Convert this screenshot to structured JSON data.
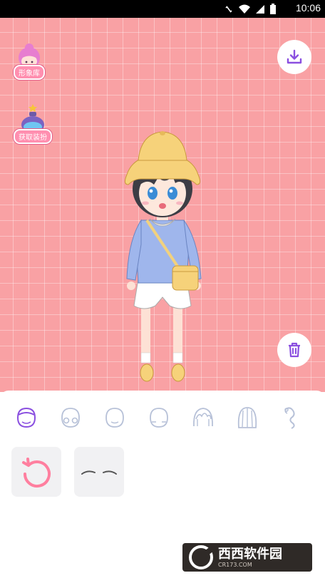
{
  "status_bar": {
    "time": "10:06",
    "icons": [
      "no-vibrate-icon",
      "wifi-icon",
      "signal-icon",
      "battery-icon"
    ]
  },
  "canvas": {
    "background_color": "#f9a1a4",
    "character_library_label": "形象库",
    "get_outfits_label": "获取装扮"
  },
  "categories": [
    {
      "name": "face-shape",
      "icon": "face-outline-icon",
      "selected": true
    },
    {
      "name": "face-eyes",
      "icon": "face-eyes-icon",
      "selected": false
    },
    {
      "name": "face-mouth",
      "icon": "face-mouth-icon",
      "selected": false
    },
    {
      "name": "face-blush",
      "icon": "face-blush-icon",
      "selected": false
    },
    {
      "name": "hair-front",
      "icon": "hair-front-icon",
      "selected": false
    },
    {
      "name": "hair-back",
      "icon": "hair-back-icon",
      "selected": false
    },
    {
      "name": "hair-accessory",
      "icon": "hair-accessory-icon",
      "selected": false
    }
  ],
  "colors": {
    "accent": "#8a4fe0",
    "pink": "#ff8fb0",
    "unselected_icon": "#b7c1d8"
  },
  "watermark": {
    "title": "西西软件园",
    "subtitle": "CR173.COM"
  }
}
